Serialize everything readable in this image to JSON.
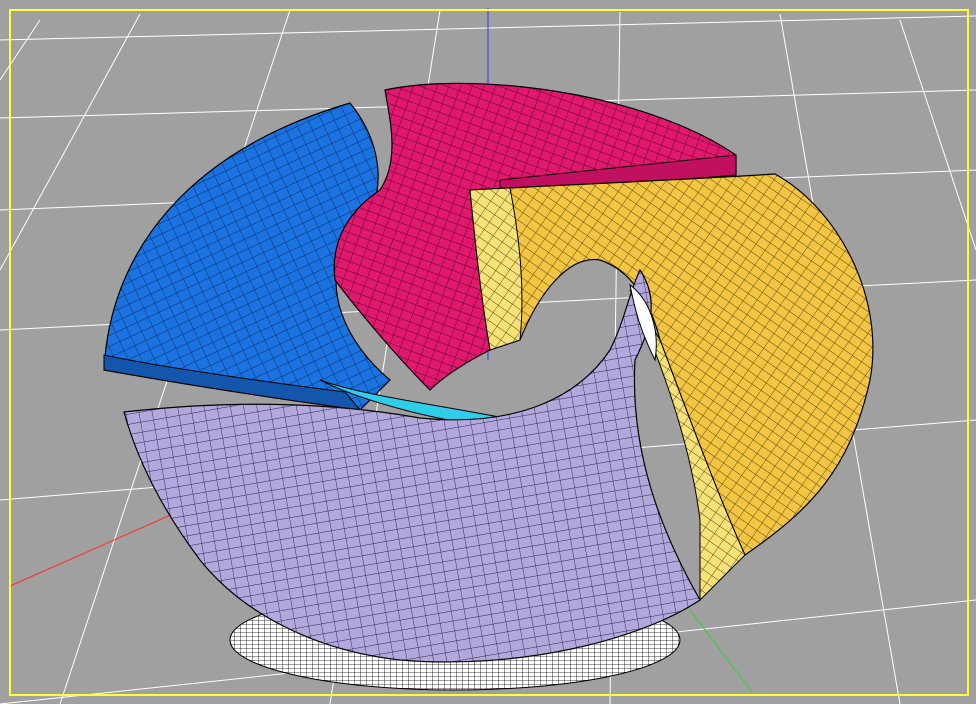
{
  "app": {
    "title": ""
  },
  "viewport": {
    "label": "",
    "background_color": "#a0a0a0",
    "border_color": "#ffff33",
    "grid_color": "#ffffff",
    "grid_visible": true
  },
  "axes": {
    "x_color": "#ff2a2a",
    "y_color": "#33cc33",
    "z_color": "#3333ff"
  },
  "model": {
    "name": "",
    "blade_count": 4,
    "render_mode": "wireframe-shaded",
    "blades": [
      {
        "name": "blade-blue",
        "color": "#1a73e0",
        "edge_color": "#0a2a66"
      },
      {
        "name": "blade-magenta",
        "color": "#e0196e",
        "edge_color": "#5a0025"
      },
      {
        "name": "blade-yellow",
        "color": "#f2c544",
        "edge_color": "#5a4500"
      },
      {
        "name": "blade-lavender",
        "color": "#b3a8dc",
        "edge_color": "#2a2250"
      }
    ],
    "hub_color": "#ffffff",
    "hub_inner_color": "#2ecde8"
  }
}
